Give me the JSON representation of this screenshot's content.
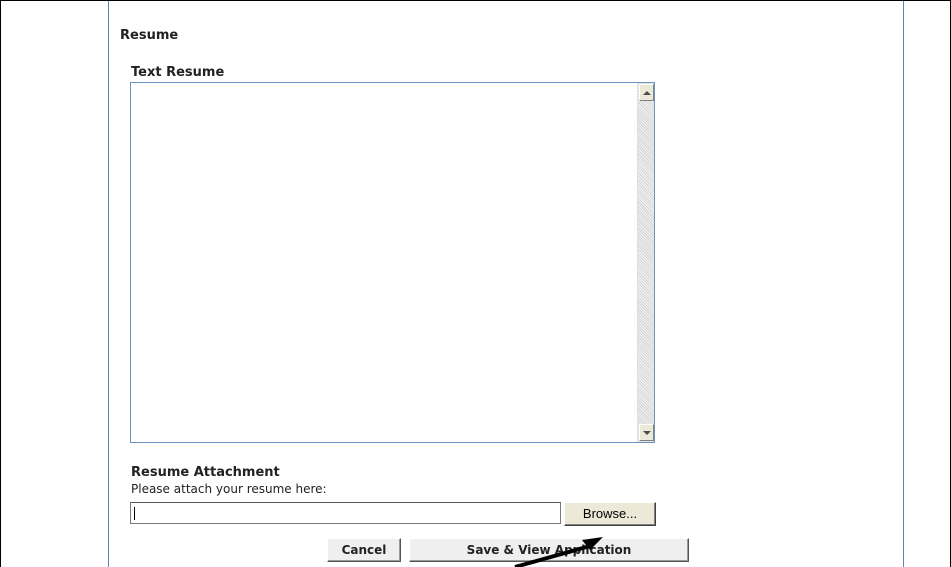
{
  "section": {
    "title": "Resume"
  },
  "text_resume": {
    "label": "Text Resume",
    "value": ""
  },
  "attachment": {
    "label": "Resume Attachment",
    "help": "Please attach your resume here:",
    "file_value": "",
    "browse_label": "Browse..."
  },
  "actions": {
    "cancel_label": "Cancel",
    "save_label": "Save & View Application"
  },
  "icons": {
    "scroll_up": "scroll-up-arrow-icon",
    "scroll_down": "scroll-down-arrow-icon",
    "annotation": "annotation-arrow-icon"
  },
  "colors": {
    "frame_line": "#5b87b3",
    "textarea_border": "#6e93c3",
    "button_face": "#ece9d8"
  }
}
